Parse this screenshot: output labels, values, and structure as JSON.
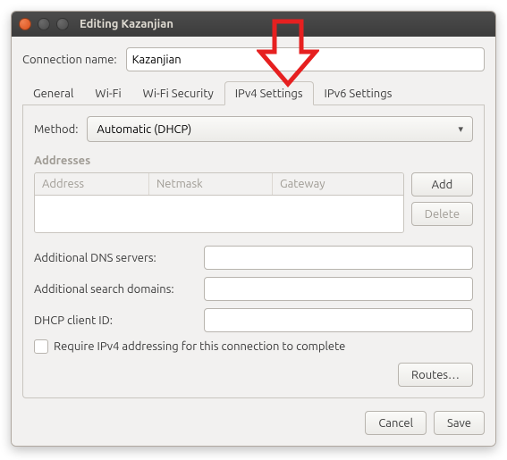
{
  "window": {
    "title": "Editing Kazanjian"
  },
  "conn": {
    "label": "Connection name:",
    "value": "Kazanjian"
  },
  "tabs": {
    "items": [
      {
        "label": "General"
      },
      {
        "label": "Wi-Fi"
      },
      {
        "label": "Wi-Fi Security"
      },
      {
        "label": "IPv4 Settings"
      },
      {
        "label": "IPv6 Settings"
      }
    ],
    "active": 3
  },
  "method": {
    "label": "Method:",
    "value": "Automatic (DHCP)"
  },
  "addresses": {
    "section": "Addresses",
    "headers": {
      "address": "Address",
      "netmask": "Netmask",
      "gateway": "Gateway"
    },
    "add": "Add",
    "delete": "Delete"
  },
  "fields": {
    "dns": {
      "label": "Additional DNS servers:",
      "value": ""
    },
    "search": {
      "label": "Additional search domains:",
      "value": ""
    },
    "dhcp": {
      "label": "DHCP client ID:",
      "value": ""
    }
  },
  "require": {
    "label": "Require IPv4 addressing for this connection to complete",
    "checked": false
  },
  "routes": {
    "label": "Routes…"
  },
  "footer": {
    "cancel": "Cancel",
    "save": "Save"
  }
}
